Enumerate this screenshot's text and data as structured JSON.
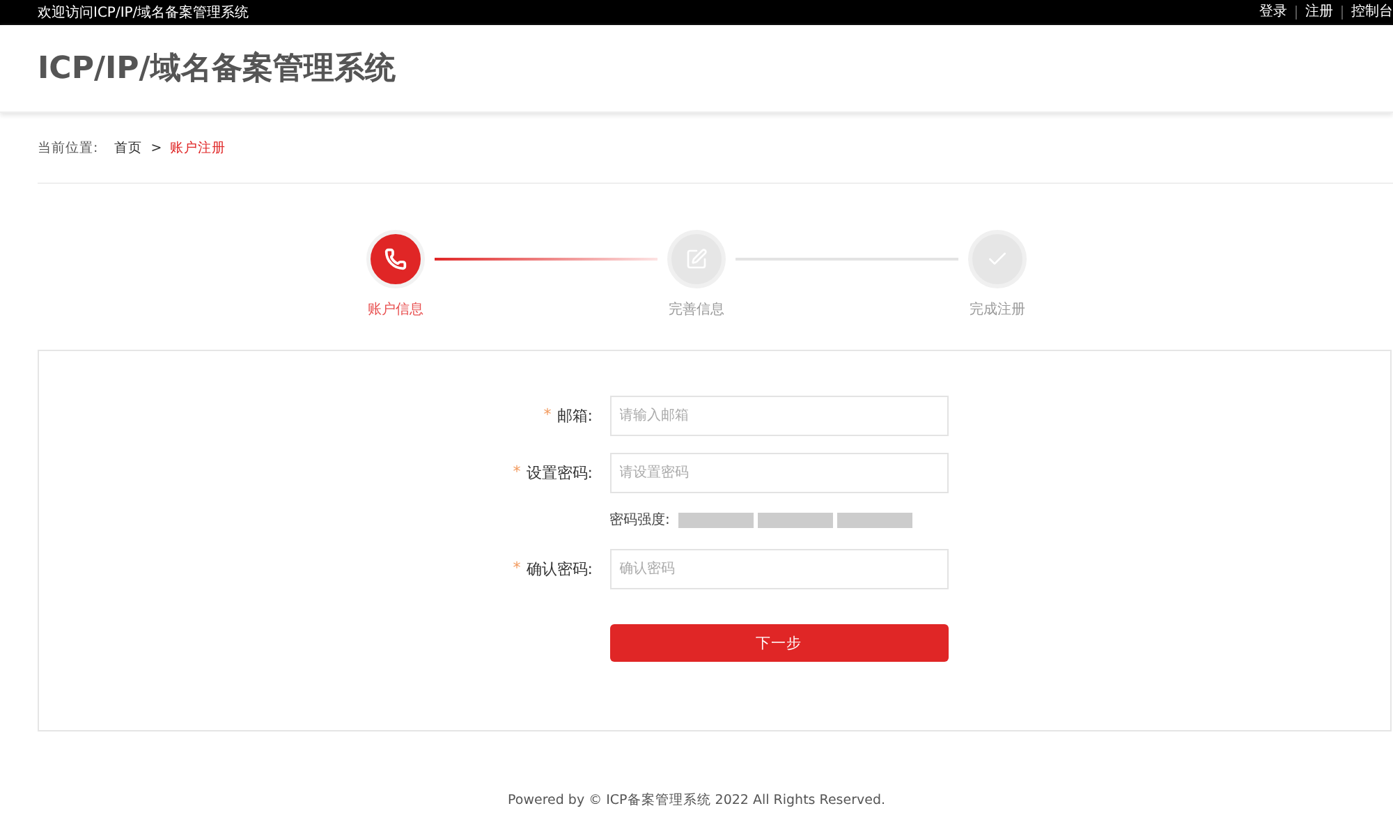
{
  "top_bar": {
    "welcome": "欢迎访问ICP/IP/域名备案管理系统",
    "links": [
      "登录",
      "注册",
      "控制台"
    ]
  },
  "header": {
    "title": "ICP/IP/域名备案管理系统"
  },
  "breadcrumb": {
    "label": "当前位置:",
    "items": [
      {
        "text": "首页",
        "selected": false
      },
      {
        "text": "账户注册",
        "selected": true
      }
    ],
    "separator": ">"
  },
  "steps": [
    {
      "label": "账户信息",
      "selected": true
    },
    {
      "label": "完善信息",
      "selected": false
    },
    {
      "label": "完成注册",
      "selected": false
    }
  ],
  "form": {
    "fields": [
      {
        "label": "邮箱:",
        "required": true,
        "placeholder": "请输入邮箱",
        "kind": "text"
      },
      {
        "label": "设置密码:",
        "required": true,
        "placeholder": "请设置密码",
        "kind": "password"
      },
      {
        "label": "密码强度:",
        "kind": "strength"
      },
      {
        "label": "确认密码:",
        "required": true,
        "placeholder": "确认密码",
        "kind": "password"
      }
    ],
    "required_mark": "*",
    "submit": "下一步"
  },
  "footer": "Powered by © ICP备案管理系统 2022 All Rights Reserved."
}
